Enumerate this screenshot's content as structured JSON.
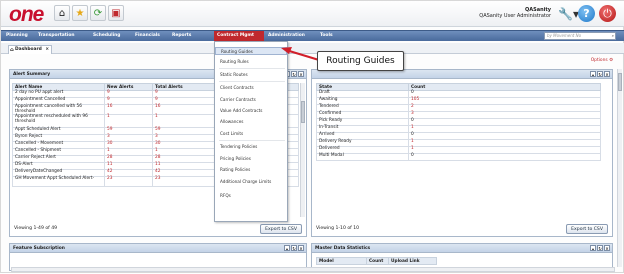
{
  "header": {
    "logo": "one",
    "user_company": "QASanity",
    "user_role": "QASanity User Administrator",
    "help_label": "?"
  },
  "menu": {
    "items": [
      "Planning",
      "Transportation",
      "Scheduling",
      "Financials",
      "Reports",
      "Contract Mgmt",
      "Administration",
      "Tools"
    ],
    "active": "Contract Mgmt",
    "search_placeholder": "by Movement No"
  },
  "tab": {
    "label": "Dashboard"
  },
  "options_label": "Options",
  "dropdown": {
    "items": [
      "Routing Guides",
      "Routing Rules",
      "Static Routes",
      "Client Contracts",
      "Carrier Contracts",
      "Value Add Contracts",
      "Allowances",
      "Cost Limits",
      "Tendering Policies",
      "Pricing Policies",
      "Rating Policies",
      "Additional Charge Limits",
      "RFQs"
    ],
    "highlighted": "Routing Guides"
  },
  "callout": {
    "text": "Routing Guides"
  },
  "alert_summary": {
    "title": "Alert Summary",
    "columns": [
      "Alert Name",
      "New Alerts",
      "Total Alerts"
    ],
    "rows": [
      [
        "2 day no PU appt alert",
        "9",
        "9"
      ],
      [
        "Appointment Cancelled",
        "9",
        "9"
      ],
      [
        "Appointment cancelled with 56 threshold",
        "16",
        "16"
      ],
      [
        "Appointment rescheduled with 96 threshold",
        "1",
        "1"
      ],
      [
        "Appt Scheduled Alert",
        "59",
        "59"
      ],
      [
        "Byron Reject",
        "3",
        "3"
      ],
      [
        "Cancelled - Movement",
        "30",
        "30"
      ],
      [
        "Cancelled - Shipment",
        "1",
        "1"
      ],
      [
        "Carrier Reject Alert",
        "28",
        "28"
      ],
      [
        "DS-Alert",
        "11",
        "11"
      ],
      [
        "DeliveryDateChanged",
        "42",
        "42"
      ],
      [
        "GH Movement Appt Scheduled Alert-",
        "23",
        "23"
      ]
    ],
    "viewing": "Viewing 1-49 of 49",
    "export_label": "Export to CSV"
  },
  "state_summary": {
    "columns": [
      "State",
      "Count"
    ],
    "rows": [
      [
        "Draft",
        "0"
      ],
      [
        "Awaiting",
        "105"
      ],
      [
        "Tendered",
        "2"
      ],
      [
        "Confirmed",
        "3"
      ],
      [
        "Pick Ready",
        "0"
      ],
      [
        "In-Transit",
        "1"
      ],
      [
        "Arrived",
        "0"
      ],
      [
        "Delivery Ready",
        "1"
      ],
      [
        "Delivered",
        "1"
      ],
      [
        "Multi Modal",
        "0"
      ]
    ],
    "viewing": "Viewing 1-10 of 10",
    "export_label": "Export to CSV"
  },
  "feature_subscription": {
    "title": "Feature Subscription"
  },
  "master_data": {
    "title": "Master Data Statistics",
    "columns": [
      "Model",
      "Count",
      "Upload Link"
    ]
  }
}
